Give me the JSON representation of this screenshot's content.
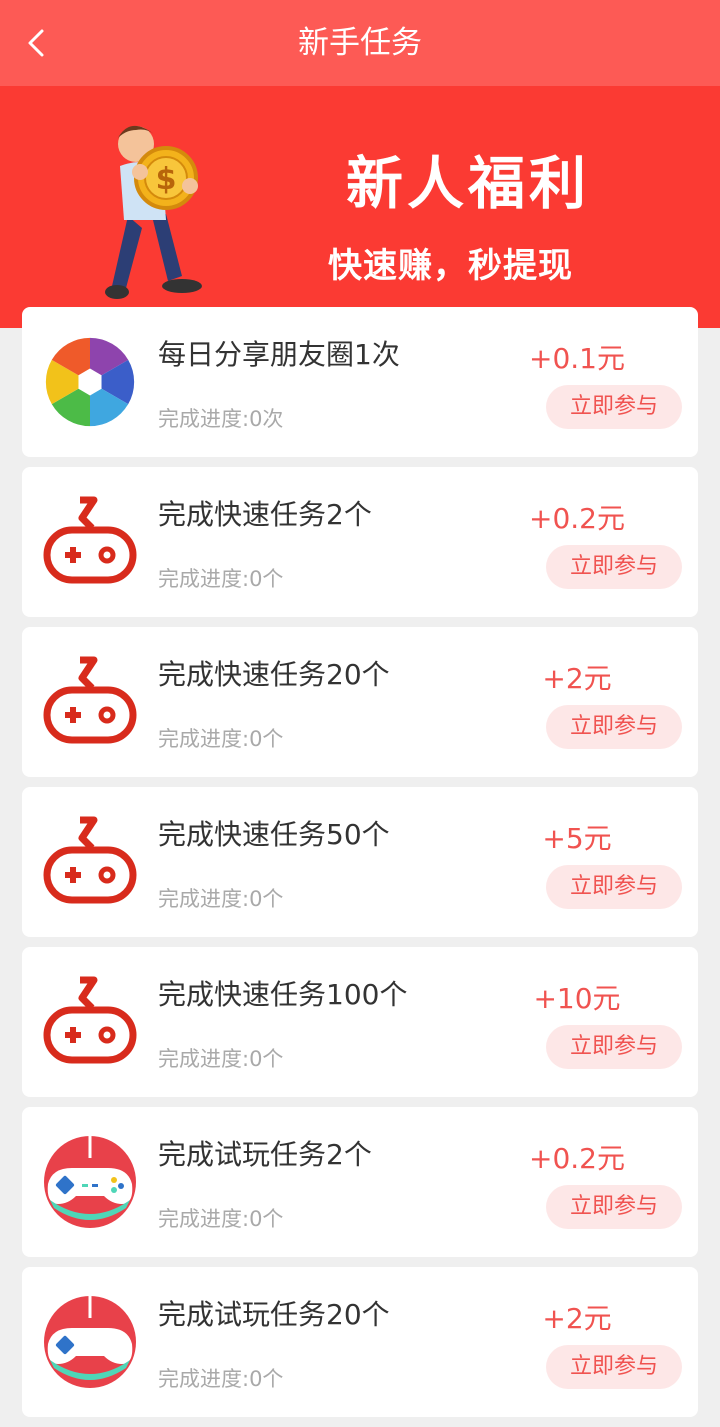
{
  "nav": {
    "title": "新手任务",
    "back_icon": "chevron-left-icon"
  },
  "banner": {
    "title": "新人福利",
    "subtitle": "快速赚，秒提现",
    "background_color": "#fb3a33",
    "mascot_icon": "man-holding-coin-illustration"
  },
  "colors": {
    "accent": "#f05350",
    "nav_bg": "#fd5a55",
    "button_bg": "#fde7e7"
  },
  "tasks": [
    {
      "icon": "camera-shutter-icon",
      "title": "每日分享朋友圈1次",
      "progress": "完成进度:0次",
      "reward": "+0.1元",
      "button": "立即参与"
    },
    {
      "icon": "gamepad-icon",
      "title": "完成快速任务2个",
      "progress": "完成进度:0个",
      "reward": "+0.2元",
      "button": "立即参与"
    },
    {
      "icon": "gamepad-icon",
      "title": "完成快速任务20个",
      "progress": "完成进度:0个",
      "reward": "+2元",
      "button": "立即参与"
    },
    {
      "icon": "gamepad-icon",
      "title": "完成快速任务50个",
      "progress": "完成进度:0个",
      "reward": "+5元",
      "button": "立即参与"
    },
    {
      "icon": "gamepad-icon",
      "title": "完成快速任务100个",
      "progress": "完成进度:0个",
      "reward": "+10元",
      "button": "立即参与"
    },
    {
      "icon": "game-controller-icon",
      "title": "完成试玩任务2个",
      "progress": "完成进度:0个",
      "reward": "+0.2元",
      "button": "立即参与"
    },
    {
      "icon": "game-controller-icon",
      "title": "完成试玩任务20个",
      "progress": "完成进度:0个",
      "reward": "+2元",
      "button": "立即参与"
    }
  ]
}
